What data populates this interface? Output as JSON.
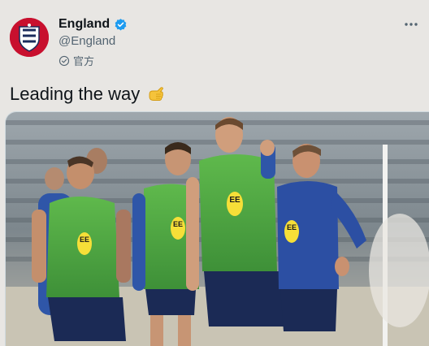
{
  "tweet": {
    "display_name": "England",
    "handle": "@England",
    "label": "官方",
    "text": "Leading the way",
    "icons": {
      "avatar": "three-lions-crest",
      "verified": "verified-badge-icon",
      "official": "official-badge-icon",
      "more": "more-icon",
      "emoji": "pointing-hand-emoji"
    },
    "colors": {
      "verified": "#1d9bf0",
      "avatar_bg": "#c8102e"
    }
  },
  "media": {
    "bib_logo": "EE"
  }
}
